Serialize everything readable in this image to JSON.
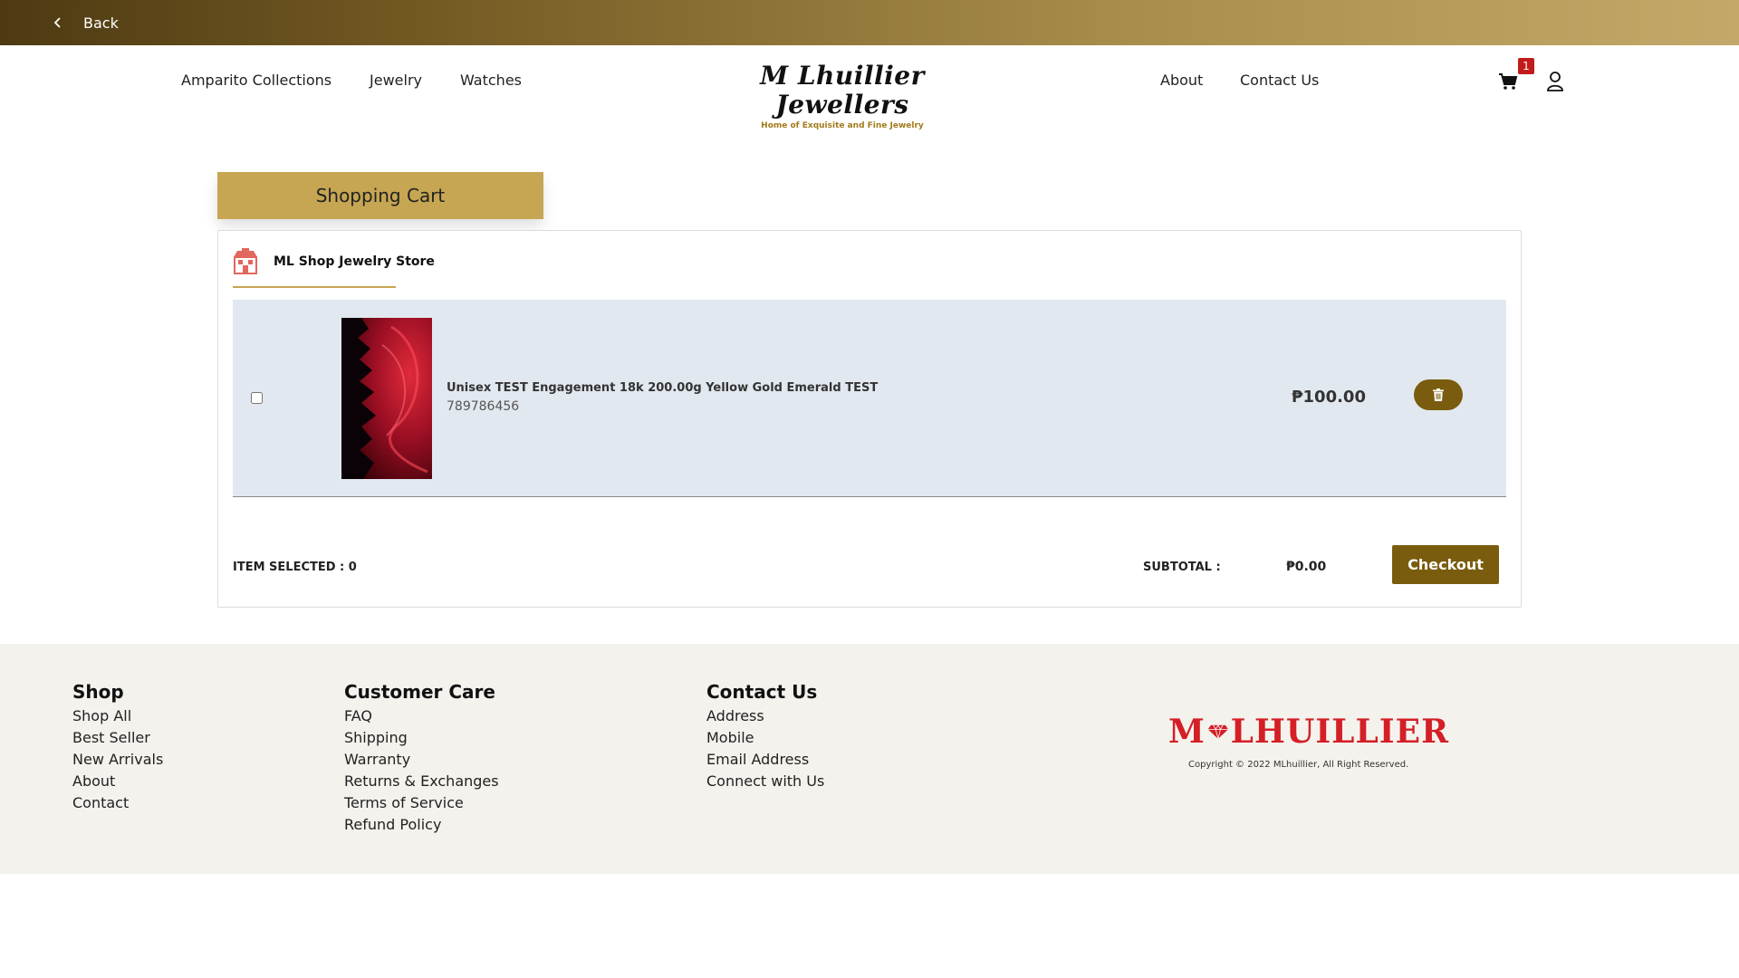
{
  "topbar": {
    "back_label": "Back"
  },
  "header": {
    "nav_left": [
      "Amparito Collections",
      "Jewelry",
      "Watches"
    ],
    "nav_right": [
      "About",
      "Contact Us"
    ],
    "logo_text": "M Lhuillier Jewellers",
    "logo_tagline": "Home of Exquisite and Fine Jewelry",
    "cart_count": "1"
  },
  "cart": {
    "title": "Shopping Cart",
    "store_name": "ML Shop Jewelry Store",
    "items": [
      {
        "name": "Unisex TEST Engagement 18k 200.00g Yellow Gold Emerald TEST",
        "sku": "789786456",
        "price": "₱100.00"
      }
    ],
    "items_selected": "ITEM SELECTED : 0",
    "subtotal_label": "SUBTOTAL :",
    "subtotal_value": "₱0.00",
    "checkout_label": "Checkout"
  },
  "footer": {
    "shop": {
      "heading": "Shop",
      "links": [
        "Shop All",
        "Best Seller",
        "New Arrivals",
        "About",
        "Contact"
      ]
    },
    "care": {
      "heading": "Customer Care",
      "links": [
        "FAQ",
        "Shipping",
        "Warranty",
        "Returns & Exchanges",
        "Terms of Service",
        "Refund Policy"
      ]
    },
    "contact": {
      "heading": "Contact Us",
      "links": [
        "Address",
        "Mobile",
        "Email Address",
        "Connect with Us"
      ]
    },
    "logo_text": "LHUILLIER",
    "logo_initial": "M",
    "copyright": "Copyright © 2022 MLhuillier, All Right Reserved."
  },
  "colors": {
    "gold": "#c6a652",
    "dark_gold": "#7a5c0e",
    "badge_red": "#c21b1b",
    "brand_red": "#d41f26",
    "row_bg": "#e2e8f0"
  },
  "icons": [
    "chevron-left-icon",
    "cart-icon",
    "user-icon",
    "store-icon",
    "trash-icon",
    "diamond-icon"
  ]
}
